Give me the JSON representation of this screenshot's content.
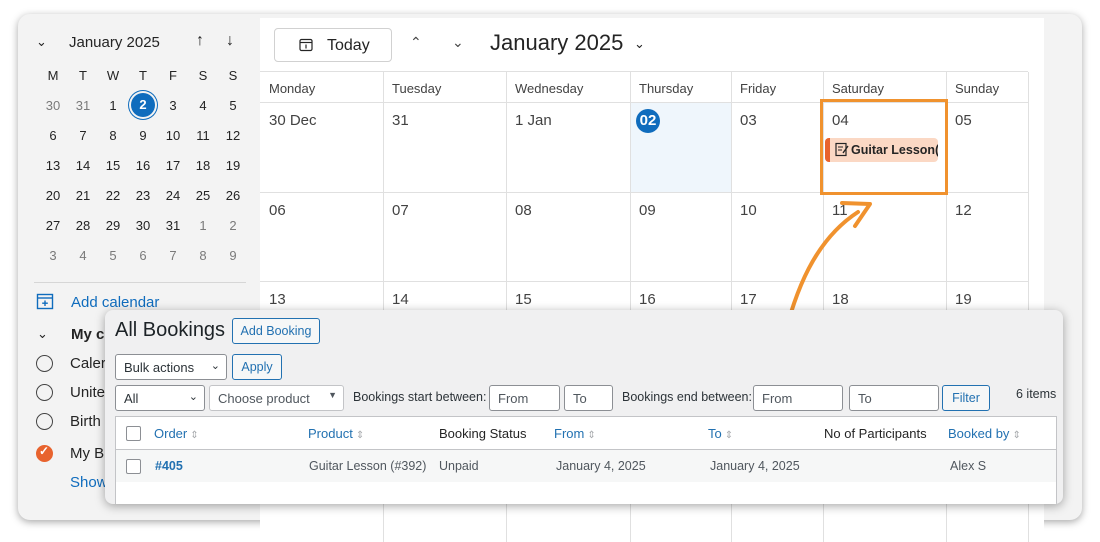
{
  "mini_calendar": {
    "month_label": "January 2025",
    "weekdays": [
      "M",
      "T",
      "W",
      "T",
      "F",
      "S",
      "S"
    ],
    "weeks": [
      [
        {
          "d": "30",
          "m": true
        },
        {
          "d": "31",
          "m": true
        },
        {
          "d": "1"
        },
        {
          "d": "2",
          "today": true
        },
        {
          "d": "3"
        },
        {
          "d": "4"
        },
        {
          "d": "5"
        }
      ],
      [
        {
          "d": "6"
        },
        {
          "d": "7"
        },
        {
          "d": "8"
        },
        {
          "d": "9"
        },
        {
          "d": "10"
        },
        {
          "d": "11"
        },
        {
          "d": "12"
        }
      ],
      [
        {
          "d": "13"
        },
        {
          "d": "14"
        },
        {
          "d": "15"
        },
        {
          "d": "16"
        },
        {
          "d": "17"
        },
        {
          "d": "18"
        },
        {
          "d": "19"
        }
      ],
      [
        {
          "d": "20"
        },
        {
          "d": "21"
        },
        {
          "d": "22"
        },
        {
          "d": "23"
        },
        {
          "d": "24"
        },
        {
          "d": "25"
        },
        {
          "d": "26"
        }
      ],
      [
        {
          "d": "27"
        },
        {
          "d": "28"
        },
        {
          "d": "29"
        },
        {
          "d": "30"
        },
        {
          "d": "31"
        },
        {
          "d": "1",
          "m": true
        },
        {
          "d": "2",
          "m": true
        }
      ],
      [
        {
          "d": "3",
          "m": true
        },
        {
          "d": "4",
          "m": true
        },
        {
          "d": "5",
          "m": true
        },
        {
          "d": "6",
          "m": true
        },
        {
          "d": "7",
          "m": true
        },
        {
          "d": "8",
          "m": true
        },
        {
          "d": "9",
          "m": true
        }
      ]
    ]
  },
  "sidebar": {
    "add_calendar": "Add calendar",
    "my_calendars": "My c",
    "calendars": [
      {
        "name": "Caler",
        "checked": false
      },
      {
        "name": "Unite",
        "checked": false
      },
      {
        "name": "Birth",
        "checked": false
      },
      {
        "name": "My B",
        "checked": true
      }
    ],
    "show_all": "Show"
  },
  "toolbar": {
    "today_label": "Today",
    "month_title": "January 2025"
  },
  "calendar": {
    "weekdays": [
      "Monday",
      "Tuesday",
      "Wednesday",
      "Thursday",
      "Friday",
      "Saturday",
      "Sunday"
    ],
    "weeks": [
      [
        "30 Dec",
        "31",
        "1 Jan",
        "02",
        "03",
        "04",
        "05"
      ],
      [
        "06",
        "07",
        "08",
        "09",
        "10",
        "11",
        "12"
      ],
      [
        "13",
        "14",
        "15",
        "16",
        "17",
        "18",
        "19"
      ]
    ],
    "today": "02",
    "event": {
      "title": "Guitar Lesson(",
      "day": "04"
    }
  },
  "bookings": {
    "title": "All Bookings",
    "add_button": "Add Booking",
    "bulk_actions": "Bulk actions",
    "apply": "Apply",
    "filter_all": "All",
    "choose_product": "Choose product",
    "start_label": "Bookings start between:",
    "end_label": "Bookings end between:",
    "from_placeholder": "From",
    "to_placeholder": "To",
    "filter_button": "Filter",
    "items_count": "6 items",
    "columns": [
      "Order",
      "Product",
      "Booking Status",
      "From",
      "To",
      "No of Participants",
      "Booked by"
    ],
    "rows": [
      {
        "order": "#405",
        "product": "Guitar Lesson (#392)",
        "status": "Unpaid",
        "from": "January 4, 2025",
        "to": "January 4, 2025",
        "participants": "",
        "booked_by": "Alex S"
      }
    ]
  },
  "colors": {
    "accent": "#0f6cbd",
    "event": "#fbd8c4",
    "event_bar": "#e8632e",
    "highlight": "#f0922e",
    "wp_blue": "#2271b1"
  }
}
